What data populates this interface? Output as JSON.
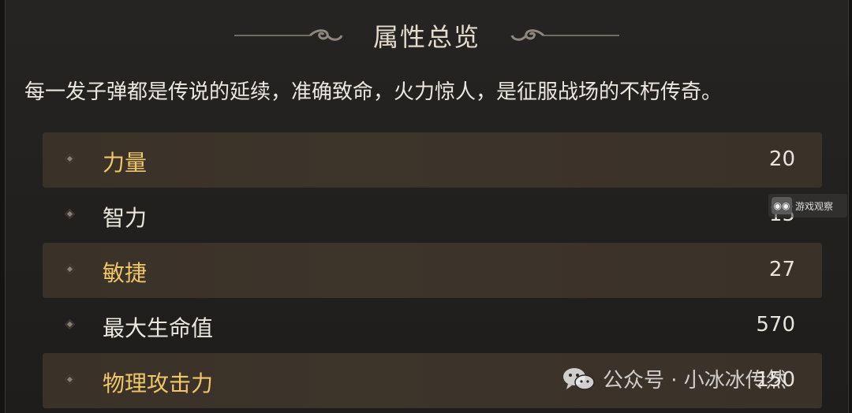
{
  "header": {
    "title": "属性总览"
  },
  "description": "每一发子弹都是传说的延续，准确致命，火力惊人，是征服战场的不朽传奇。",
  "stats": [
    {
      "label": "力量",
      "value": "20",
      "style": "highlight"
    },
    {
      "label": "智力",
      "value": "15",
      "style": "dark"
    },
    {
      "label": "敏捷",
      "value": "27",
      "style": "highlight"
    },
    {
      "label": "最大生命值",
      "value": "570",
      "style": "dark"
    },
    {
      "label": "物理攻击力",
      "value": "150",
      "style": "highlight"
    }
  ],
  "watermark": {
    "text": "公众号 · 小冰冰传然",
    "icon": "wechat-icon"
  },
  "corner_badge": {
    "text": "游戏观察",
    "icon": "logo-icon"
  },
  "colors": {
    "label_highlight": "#f0c66a",
    "label_normal": "#ebe7df",
    "row_highlight": "#3a3128",
    "background": "#1e1d1b"
  }
}
